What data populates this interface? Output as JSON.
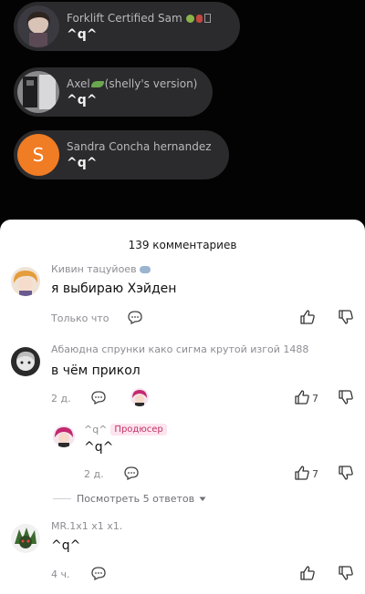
{
  "chats": [
    {
      "name": "Forklift Certified Sam",
      "message": "^q^"
    },
    {
      "name_prefix": "Axel",
      "name_suffix": "(shelly's version)",
      "message": "^q^"
    },
    {
      "name": "Sandra Concha hernandez",
      "message": "^q^",
      "avatar_letter": "S",
      "avatar_color": "#f07c24"
    }
  ],
  "comments_sheet": {
    "title": "139 комментариев",
    "comments": [
      {
        "author": "Кивин тацуйоев",
        "text": "я выбираю Хэйден",
        "time": "Только что"
      },
      {
        "author": "Абаюдна спрунки како сигма крутой изгой 1488",
        "text": "в чём прикол",
        "time": "2 д.",
        "likes": "7"
      },
      {
        "author": "^q^",
        "badge": "Продюсер",
        "text": "^q^",
        "time": "2 д.",
        "likes": "7"
      },
      {
        "author": "MR.1x1 x1 x1.",
        "text": "^q^",
        "time": "4 ч."
      }
    ],
    "view_replies": "Посмотреть 5 ответов"
  },
  "colors": {
    "badge_text": "#c0356b",
    "badge_bg": "#fde4ee",
    "chat_bg": "#2b2b2d"
  }
}
